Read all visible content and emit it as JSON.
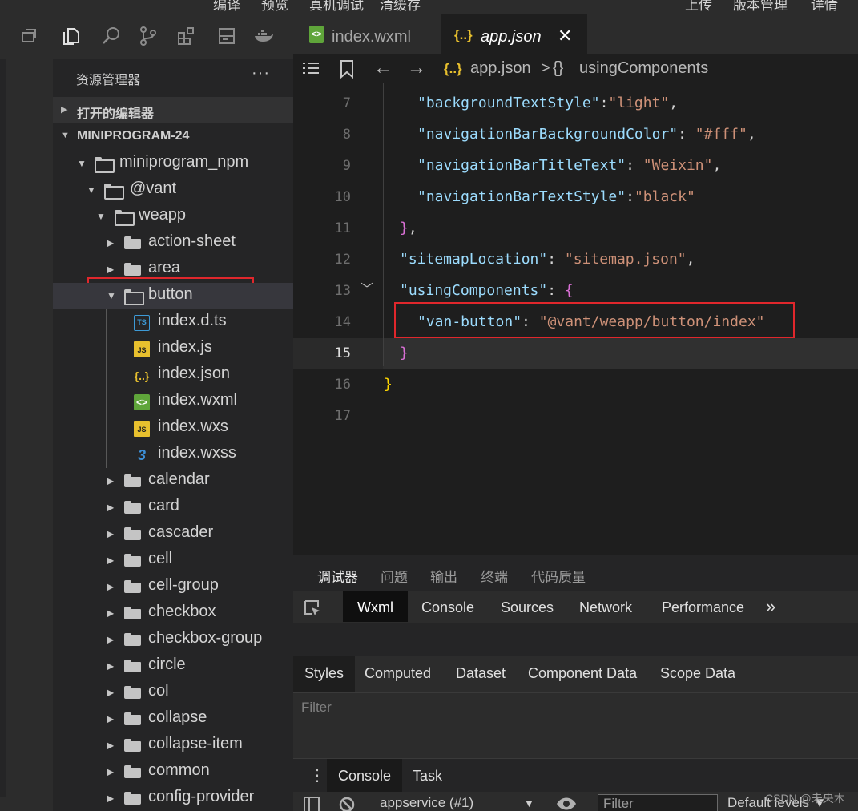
{
  "menu": {
    "items": [
      "编译",
      "预览",
      "真机调试",
      "清缓存"
    ],
    "right_items": [
      "上传",
      "版本管理",
      "详情"
    ]
  },
  "explorer": {
    "title": "资源管理器",
    "more": "···",
    "sections": [
      {
        "label": "打开的编辑器"
      },
      {
        "label": "MINIPROGRAM-24"
      }
    ],
    "tree": [
      {
        "label": "miniprogram_npm"
      },
      {
        "label": "@vant"
      },
      {
        "label": "weapp"
      },
      {
        "label": "action-sheet"
      },
      {
        "label": "area"
      },
      {
        "label": "button"
      },
      {
        "label": "index.d.ts",
        "icon": "TS"
      },
      {
        "label": "index.js",
        "icon": "JS"
      },
      {
        "label": "index.json",
        "icon": "{..}"
      },
      {
        "label": "index.wxml",
        "icon": "<>"
      },
      {
        "label": "index.wxs",
        "icon": "JS"
      },
      {
        "label": "index.wxss",
        "icon": "3"
      },
      {
        "label": "calendar"
      },
      {
        "label": "card"
      },
      {
        "label": "cascader"
      },
      {
        "label": "cell"
      },
      {
        "label": "cell-group"
      },
      {
        "label": "checkbox"
      },
      {
        "label": "checkbox-group"
      },
      {
        "label": "circle"
      },
      {
        "label": "col"
      },
      {
        "label": "collapse"
      },
      {
        "label": "collapse-item"
      },
      {
        "label": "common"
      },
      {
        "label": "config-provider"
      }
    ]
  },
  "tabs": [
    {
      "label": "index.wxml",
      "icon": "<>"
    },
    {
      "label": "app.json",
      "icon": "{..}",
      "close": "✕"
    }
  ],
  "breadcrumb": {
    "file_icon": "{..}",
    "file": "app.json",
    "sep": ">",
    "sym_icon": "{}",
    "symbol": "usingComponents"
  },
  "editor": {
    "lines": [
      {
        "n": "7",
        "key": "\"backgroundTextStyle\"",
        "sep": ":",
        "val": "\"light\"",
        "end": ","
      },
      {
        "n": "8",
        "key": "\"navigationBarBackgroundColor\"",
        "sep": ": ",
        "val": "\"#fff\"",
        "end": ","
      },
      {
        "n": "9",
        "key": "\"navigationBarTitleText\"",
        "sep": ": ",
        "val": "\"Weixin\"",
        "end": ","
      },
      {
        "n": "10",
        "key": "\"navigationBarTextStyle\"",
        "sep": ":",
        "val": "\"black\"",
        "end": ""
      },
      {
        "n": "11",
        "text": "},"
      },
      {
        "n": "12",
        "key": "\"sitemapLocation\"",
        "sep": ": ",
        "val": "\"sitemap.json\"",
        "end": ","
      },
      {
        "n": "13",
        "key": "\"usingComponents\"",
        "sep": ": ",
        "brace": "{"
      },
      {
        "n": "14",
        "key": "\"van-button\"",
        "sep": ": ",
        "val": "\"@vant/weapp/button/index\"",
        "end": ""
      },
      {
        "n": "15",
        "text": "}"
      },
      {
        "n": "16",
        "text": "}"
      },
      {
        "n": "17",
        "text": ""
      }
    ]
  },
  "panel": {
    "tabs": [
      "调试器",
      "问题",
      "输出",
      "终端",
      "代码质量"
    ],
    "devtools_tabs": [
      "Wxml",
      "Console",
      "Sources",
      "Network",
      "Performance",
      "»"
    ],
    "styles_tabs": [
      "Styles",
      "Computed",
      "Dataset",
      "Component Data",
      "Scope Data"
    ],
    "filter_placeholder": "Filter",
    "console_tabs": [
      "Console",
      "Task"
    ],
    "console_dots": "⋮",
    "context": "appservice (#1)",
    "context_arrow": "▼",
    "filter_label": "Filter",
    "levels": "Default levels ▼"
  },
  "watermark": "CSDN @未央木",
  "colors": {
    "key": "#9cdcfe",
    "string": "#ce9178",
    "brace_outer": "#ffd700",
    "brace_inner": "#da70d6",
    "highlight": "#e0272c"
  }
}
